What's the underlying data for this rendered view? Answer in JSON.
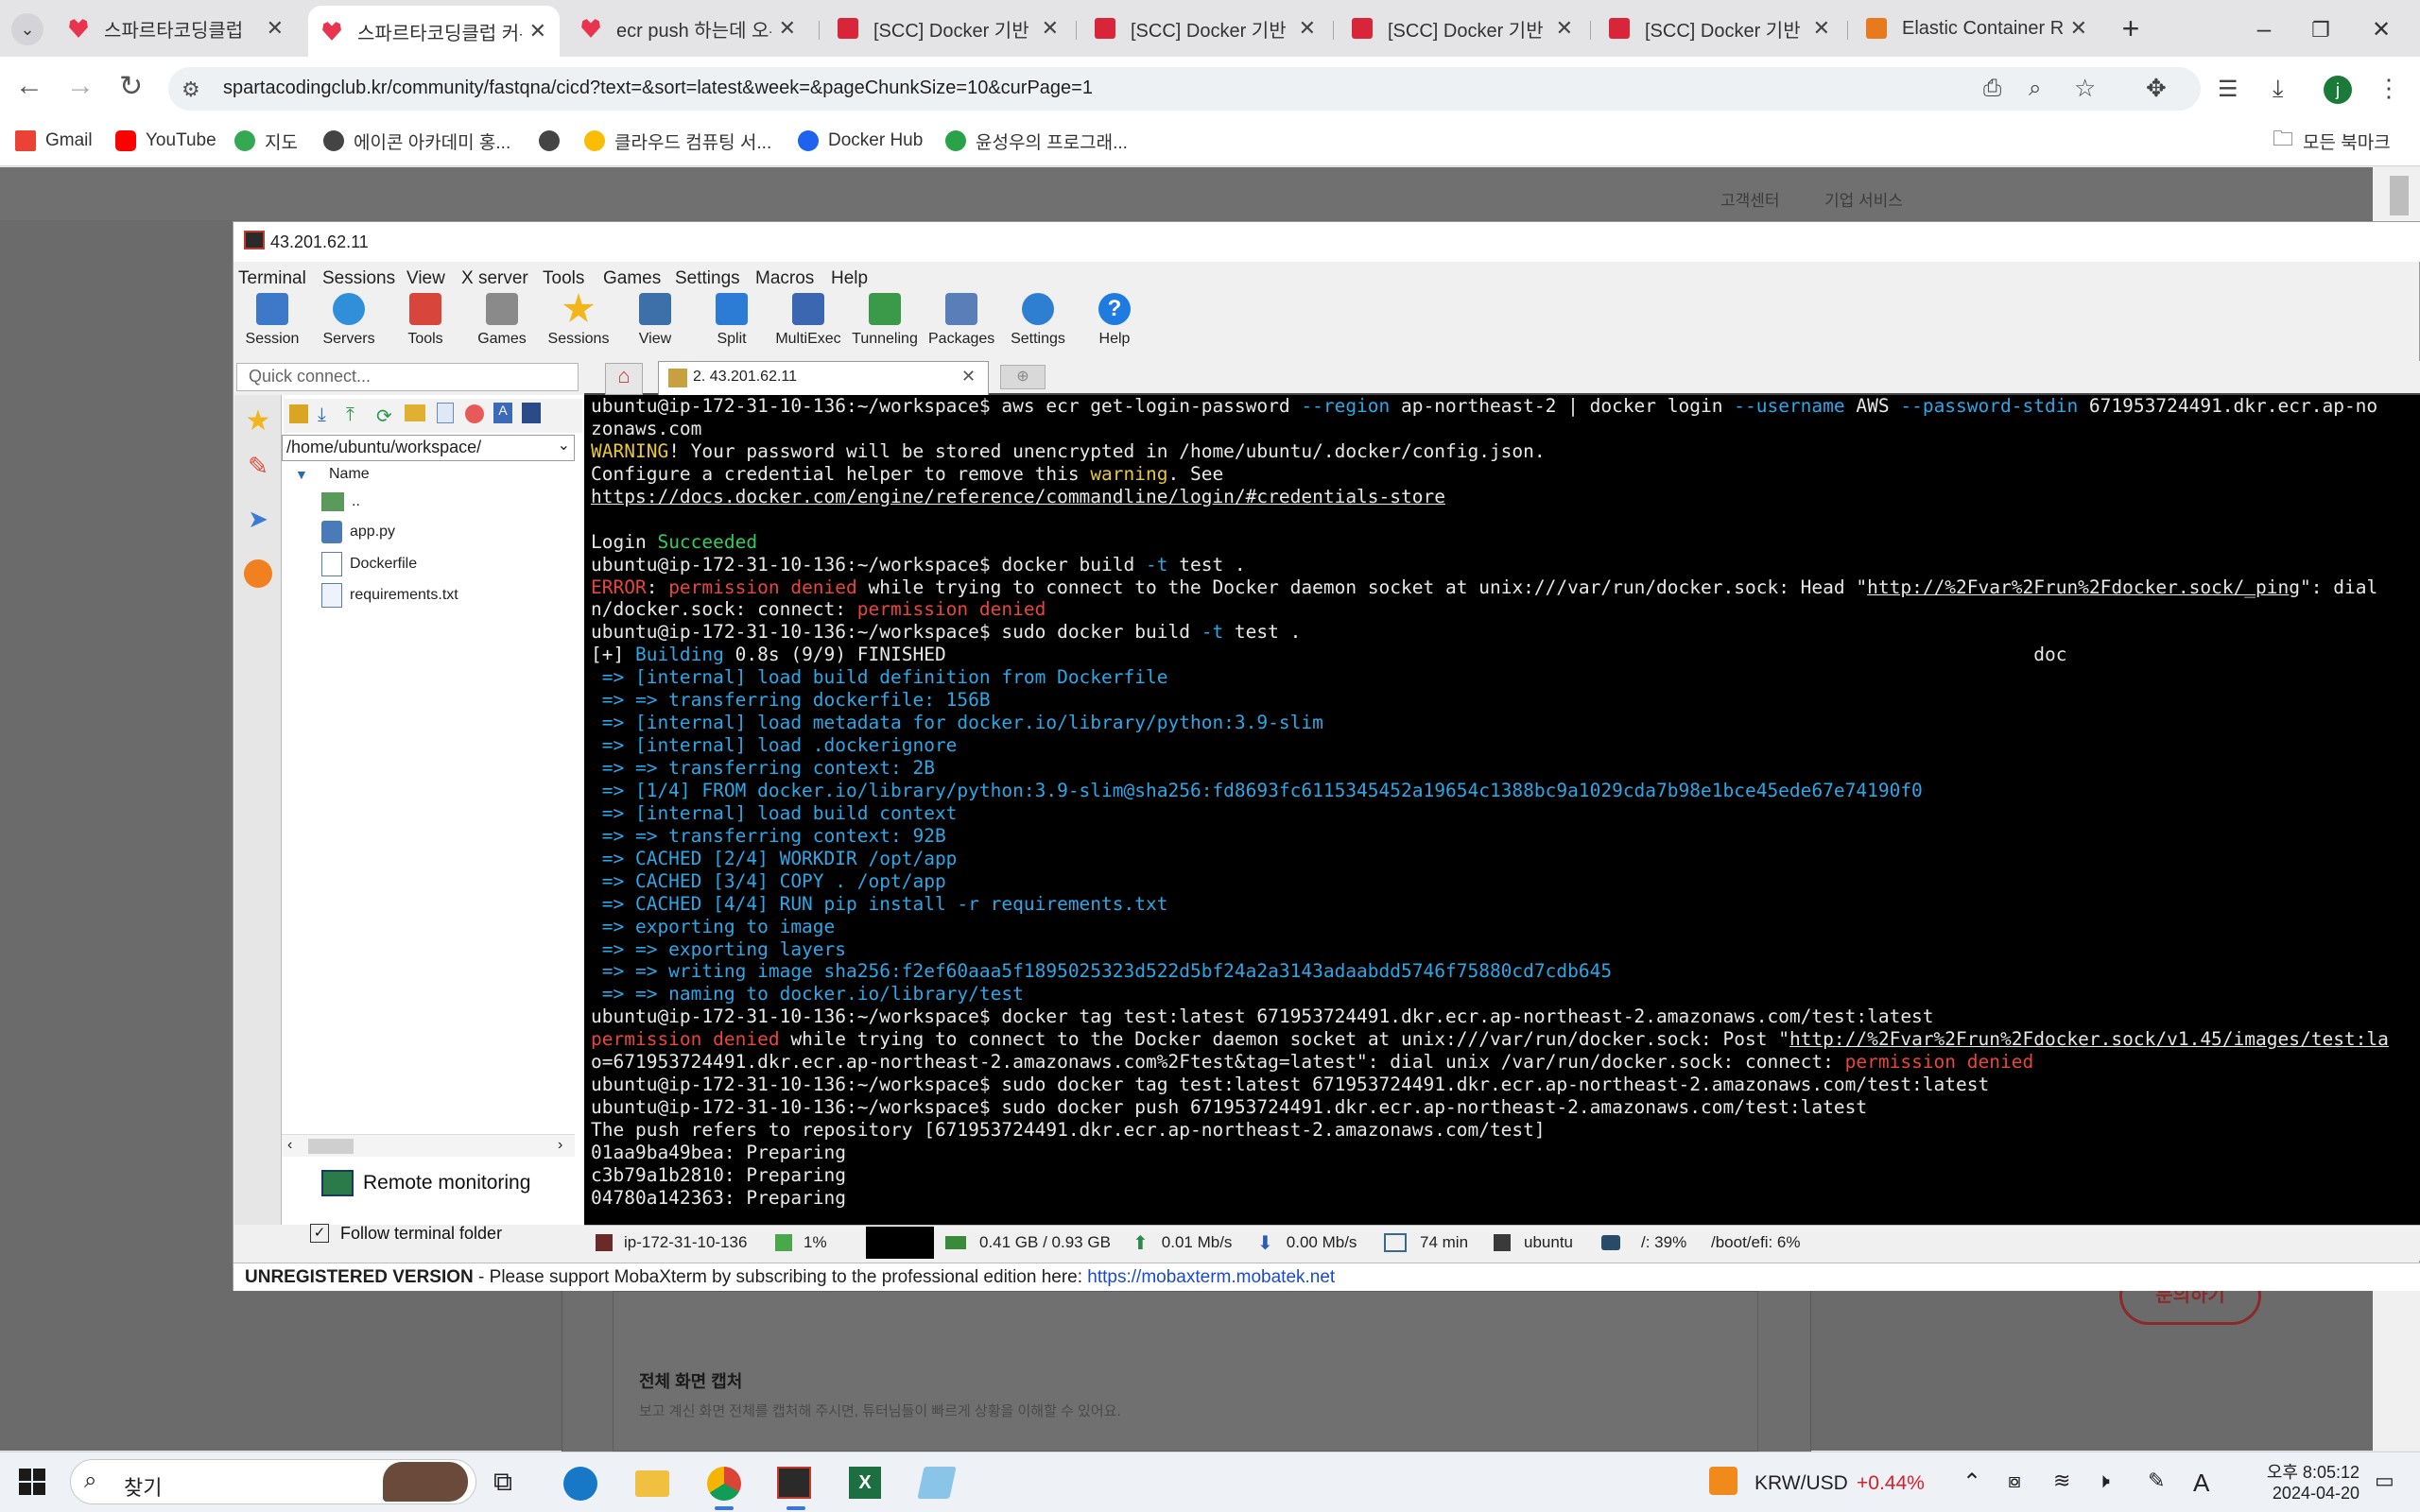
{
  "browser": {
    "tabs": [
      {
        "title": "스파르타코딩클럽",
        "icon": "heart-icon"
      },
      {
        "title": "스파르타코딩클럽 커뮤니티",
        "icon": "heart-icon",
        "active": true
      },
      {
        "title": "ecr push 하는데 오류",
        "icon": "heart-icon"
      },
      {
        "title": "[SCC] Docker 기반 CI/CD",
        "icon": "book-icon"
      },
      {
        "title": "[SCC] Docker 기반 CI/CD",
        "icon": "book-icon"
      },
      {
        "title": "[SCC] Docker 기반 CI/CD",
        "icon": "book-icon"
      },
      {
        "title": "[SCC] Docker 기반 CI/CD",
        "icon": "book-icon"
      },
      {
        "title": "Elastic Container Registry",
        "icon": "ecs-icon"
      }
    ],
    "url": "spartacodingclub.kr/community/fastqna/cicd?text=&sort=latest&week=&pageChunkSize=10&curPage=1",
    "bookmarks": [
      "Gmail",
      "YouTube",
      "지도",
      "에이콘 아카데미 홍...",
      "",
      "클라우드 컴퓨팅 서...",
      "Docker Hub",
      "윤성우의 프로그래..."
    ],
    "all_bookmarks": "모든 북마크",
    "profile_initial": "j"
  },
  "site": {
    "top_links": [
      "고객센터",
      "기업 서비스"
    ],
    "section_title": "전체 화면 캡처",
    "section_desc": "보고 계신 화면 전체를 캡처해 주시면, 튜터님들이 빠르게 상황을 이해할 수 있어요.",
    "side_button": "문의하기"
  },
  "moba": {
    "window_title": "43.201.62.11",
    "menu": [
      "Terminal",
      "Sessions",
      "View",
      "X server",
      "Tools",
      "Games",
      "Settings",
      "Macros",
      "Help"
    ],
    "toolbar": [
      "Session",
      "Servers",
      "Tools",
      "Games",
      "Sessions",
      "View",
      "Split",
      "MultiExec",
      "Tunneling",
      "Packages",
      "Settings",
      "Help"
    ],
    "quick_connect": "Quick connect...",
    "tab_label": "2. 43.201.62.11",
    "path": "/home/ubuntu/workspace/",
    "tree_header": "Name",
    "files": [
      "..",
      "app.py",
      "Dockerfile",
      "requirements.txt"
    ],
    "remote_monitoring": "Remote monitoring",
    "follow_folder": "Follow terminal folder",
    "status": {
      "host": "ip-172-31-10-136",
      "cpu": "1%",
      "memory": "0.41 GB / 0.93 GB",
      "upload": "0.01 Mb/s",
      "download": "0.00 Mb/s",
      "uptime": "74 min",
      "user": "ubuntu",
      "disk": "/: 39%",
      "boot": "/boot/efi: 6%"
    },
    "unregistered": "UNREGISTERED VERSION",
    "support_text": " -  Please support MobaXterm by subscribing to the professional edition here:  ",
    "support_link": "https://mobaxterm.mobatek.net",
    "terminal": [
      [
        [
          "w",
          "ubuntu@ip-172-31-10-136:~/workspace$ aws ecr get-login-password "
        ],
        [
          "b",
          "--region"
        ],
        [
          "w",
          " ap-northeast-2 | docker login "
        ],
        [
          "b",
          "--username"
        ],
        [
          "w",
          " AWS "
        ],
        [
          "b",
          "--password-stdin"
        ],
        [
          "w",
          " 671953724491.dkr.ecr.ap-no"
        ]
      ],
      [
        [
          "w",
          "zonaws.com"
        ]
      ],
      [
        [
          "y",
          "WARNING"
        ],
        [
          "w",
          "! Your password will be stored unencrypted in /home/ubuntu/.docker/config.json."
        ]
      ],
      [
        [
          "w",
          "Configure a credential helper to remove this "
        ],
        [
          "y",
          "warning"
        ],
        [
          "w",
          ". See"
        ]
      ],
      [
        [
          "u",
          "https://docs.docker.com/engine/reference/commandline/login/#credentials-store"
        ]
      ],
      [
        [
          "w",
          " "
        ]
      ],
      [
        [
          "w",
          "Login "
        ],
        [
          "g",
          "Succeeded"
        ]
      ],
      [
        [
          "w",
          "ubuntu@ip-172-31-10-136:~/workspace$ docker build "
        ],
        [
          "b",
          "-t"
        ],
        [
          "w",
          " test ."
        ]
      ],
      [
        [
          "r",
          "ERROR"
        ],
        [
          "w",
          ": "
        ],
        [
          "r",
          "permission denied"
        ],
        [
          "w",
          " while trying to connect to the Docker daemon socket at unix:///var/run/docker.sock: Head \""
        ],
        [
          "u",
          "http://%2Fvar%2Frun%2Fdocker.sock/_ping"
        ],
        [
          "w",
          "\": dial"
        ]
      ],
      [
        [
          "w",
          "n/docker.sock: connect: "
        ],
        [
          "r",
          "permission denied"
        ]
      ],
      [
        [
          "w",
          "ubuntu@ip-172-31-10-136:~/workspace$ sudo docker build "
        ],
        [
          "b",
          "-t"
        ],
        [
          "w",
          " test ."
        ]
      ],
      [
        [
          "w",
          "[+] "
        ],
        [
          "b",
          "Building"
        ],
        [
          "w",
          " 0.8s (9/9) FINISHED                                                                                                  doc"
        ]
      ],
      [
        [
          "b",
          " => [internal] load build definition from Dockerfile"
        ]
      ],
      [
        [
          "b",
          " => => transferring dockerfile: 156B"
        ]
      ],
      [
        [
          "b",
          " => [internal] load metadata for docker.io/library/python:3.9-slim"
        ]
      ],
      [
        [
          "b",
          " => [internal] load .dockerignore"
        ]
      ],
      [
        [
          "b",
          " => => transferring context: 2B"
        ]
      ],
      [
        [
          "b",
          " => [1/4] FROM docker.io/library/python:3.9-slim@sha256:fd8693fc6115345452a19654c1388bc9a1029cda7b98e1bce45ede67e74190f0"
        ]
      ],
      [
        [
          "b",
          " => [internal] load build context"
        ]
      ],
      [
        [
          "b",
          " => => transferring context: 92B"
        ]
      ],
      [
        [
          "b",
          " => CACHED [2/4] WORKDIR /opt/app"
        ]
      ],
      [
        [
          "b",
          " => CACHED [3/4] COPY . /opt/app"
        ]
      ],
      [
        [
          "b",
          " => CACHED [4/4] RUN pip install -r requirements.txt"
        ]
      ],
      [
        [
          "b",
          " => exporting to image"
        ]
      ],
      [
        [
          "b",
          " => => exporting layers"
        ]
      ],
      [
        [
          "b",
          " => => writing image sha256:f2ef60aaa5f1895025323d522d5bf24a2a3143adaabdd5746f75880cd7cdb645"
        ]
      ],
      [
        [
          "b",
          " => => naming to docker.io/library/test"
        ]
      ],
      [
        [
          "w",
          "ubuntu@ip-172-31-10-136:~/workspace$ docker tag test:latest 671953724491.dkr.ecr.ap-northeast-2.amazonaws.com/test:latest"
        ]
      ],
      [
        [
          "r",
          "permission denied"
        ],
        [
          "w",
          " while trying to connect to the Docker daemon socket at unix:///var/run/docker.sock: Post \""
        ],
        [
          "u",
          "http://%2Fvar%2Frun%2Fdocker.sock/v1.45/images/test:la"
        ]
      ],
      [
        [
          "w",
          "o=671953724491.dkr.ecr.ap-northeast-2.amazonaws.com%2Ftest&tag=latest\": dial unix /var/run/docker.sock: connect: "
        ],
        [
          "r",
          "permission denied"
        ]
      ],
      [
        [
          "w",
          "ubuntu@ip-172-31-10-136:~/workspace$ sudo docker tag test:latest 671953724491.dkr.ecr.ap-northeast-2.amazonaws.com/test:latest"
        ]
      ],
      [
        [
          "w",
          "ubuntu@ip-172-31-10-136:~/workspace$ sudo docker push 671953724491.dkr.ecr.ap-northeast-2.amazonaws.com/test:latest"
        ]
      ],
      [
        [
          "w",
          "The push refers to repository [671953724491.dkr.ecr.ap-northeast-2.amazonaws.com/test]"
        ]
      ],
      [
        [
          "w",
          "01aa9ba49bea: Preparing"
        ]
      ],
      [
        [
          "w",
          "c3b79a1b2810: Preparing"
        ]
      ],
      [
        [
          "w",
          "04780a142363: Preparing"
        ]
      ]
    ]
  },
  "taskbar": {
    "search": "찾기",
    "currency": "KRW/USD",
    "currency_change": "+0.44%",
    "ime": "A",
    "time": "오후 8:05:12",
    "date": "2024-04-20"
  },
  "colors": {
    "accent_red": "#e8344e",
    "terminal_bg": "#000000",
    "term_blue": "#2ca7e8",
    "term_yellow": "#e8c838",
    "term_green": "#2ccf5b",
    "term_red": "#e8453c"
  }
}
